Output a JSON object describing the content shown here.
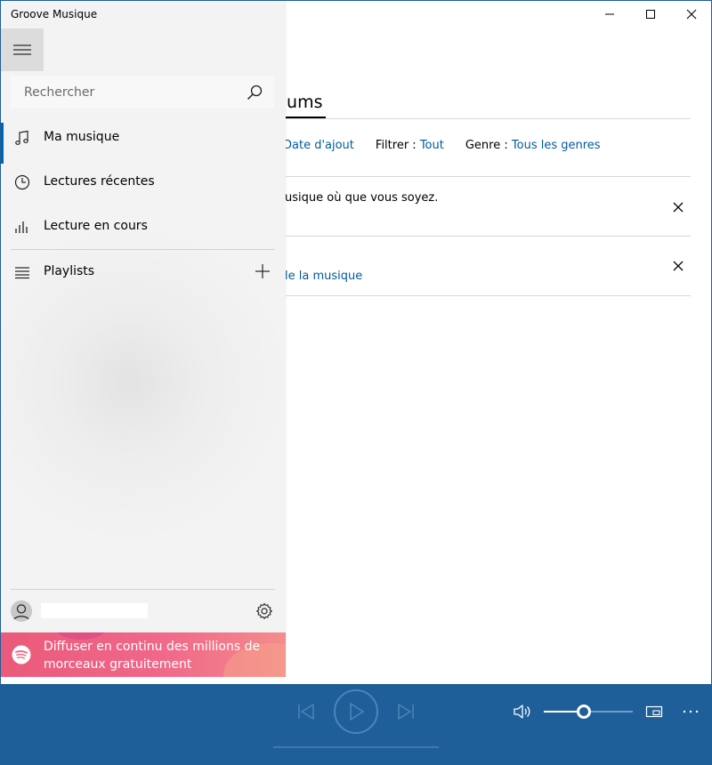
{
  "app": {
    "title": "Groove Musique"
  },
  "search": {
    "placeholder": "Rechercher"
  },
  "nav": {
    "items": [
      {
        "label": "Ma musique",
        "icon": "music-note-icon",
        "active": true
      },
      {
        "label": "Lectures récentes",
        "icon": "clock-icon"
      },
      {
        "label": "Lecture en cours",
        "icon": "equalizer-icon"
      },
      {
        "label": "Playlists",
        "icon": "playlist-icon"
      }
    ],
    "spotify_text": "Diffuser en continu des millions de morceaux gratuitement"
  },
  "main": {
    "header": "bums",
    "filters": {
      "sort_value": "Date d'ajout",
      "filter_label": "Filtrer :",
      "filter_value": "Tout",
      "genre_label": "Genre :",
      "genre_value": "Tous les genres"
    },
    "notices": [
      {
        "text": "usique où que vous soyez."
      },
      {
        "text": "le la musique"
      }
    ]
  },
  "player": {
    "volume_level": 0.45
  },
  "colors": {
    "accent": "#0063b1",
    "player_bg": "#1e5f99",
    "link": "#005a9e",
    "spotify_banner": "#ee6686"
  }
}
